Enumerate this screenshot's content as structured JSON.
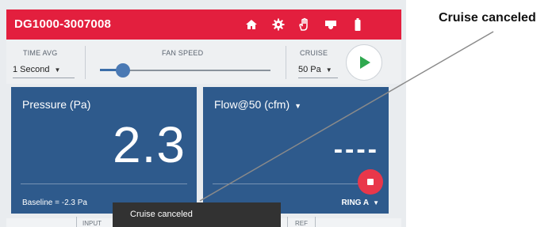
{
  "header": {
    "device_id": "DG1000-3007008",
    "icons": [
      "home-icon",
      "gear-icon",
      "hand-icon",
      "network-icon",
      "battery-icon"
    ],
    "color": "#e31f3e"
  },
  "controls": {
    "time_avg": {
      "label": "TIME AVG",
      "value": "1 Second"
    },
    "fan_speed": {
      "label": "FAN SPEED",
      "level": 0.12
    },
    "cruise": {
      "label": "CRUISE",
      "value": "50 Pa"
    }
  },
  "panels": {
    "pressure": {
      "title": "Pressure (Pa)",
      "value": "2.3",
      "baseline": "Baseline = -2.3 Pa"
    },
    "flow": {
      "title": "Flow@50 (cfm)",
      "value": "----",
      "ring": "RING A"
    },
    "color": "#2e5a8c"
  },
  "tabs": {
    "input": "INPUT",
    "ref": "REF"
  },
  "toast": {
    "message": "Cruise canceled"
  },
  "callout": {
    "label": "Cruise canceled"
  }
}
